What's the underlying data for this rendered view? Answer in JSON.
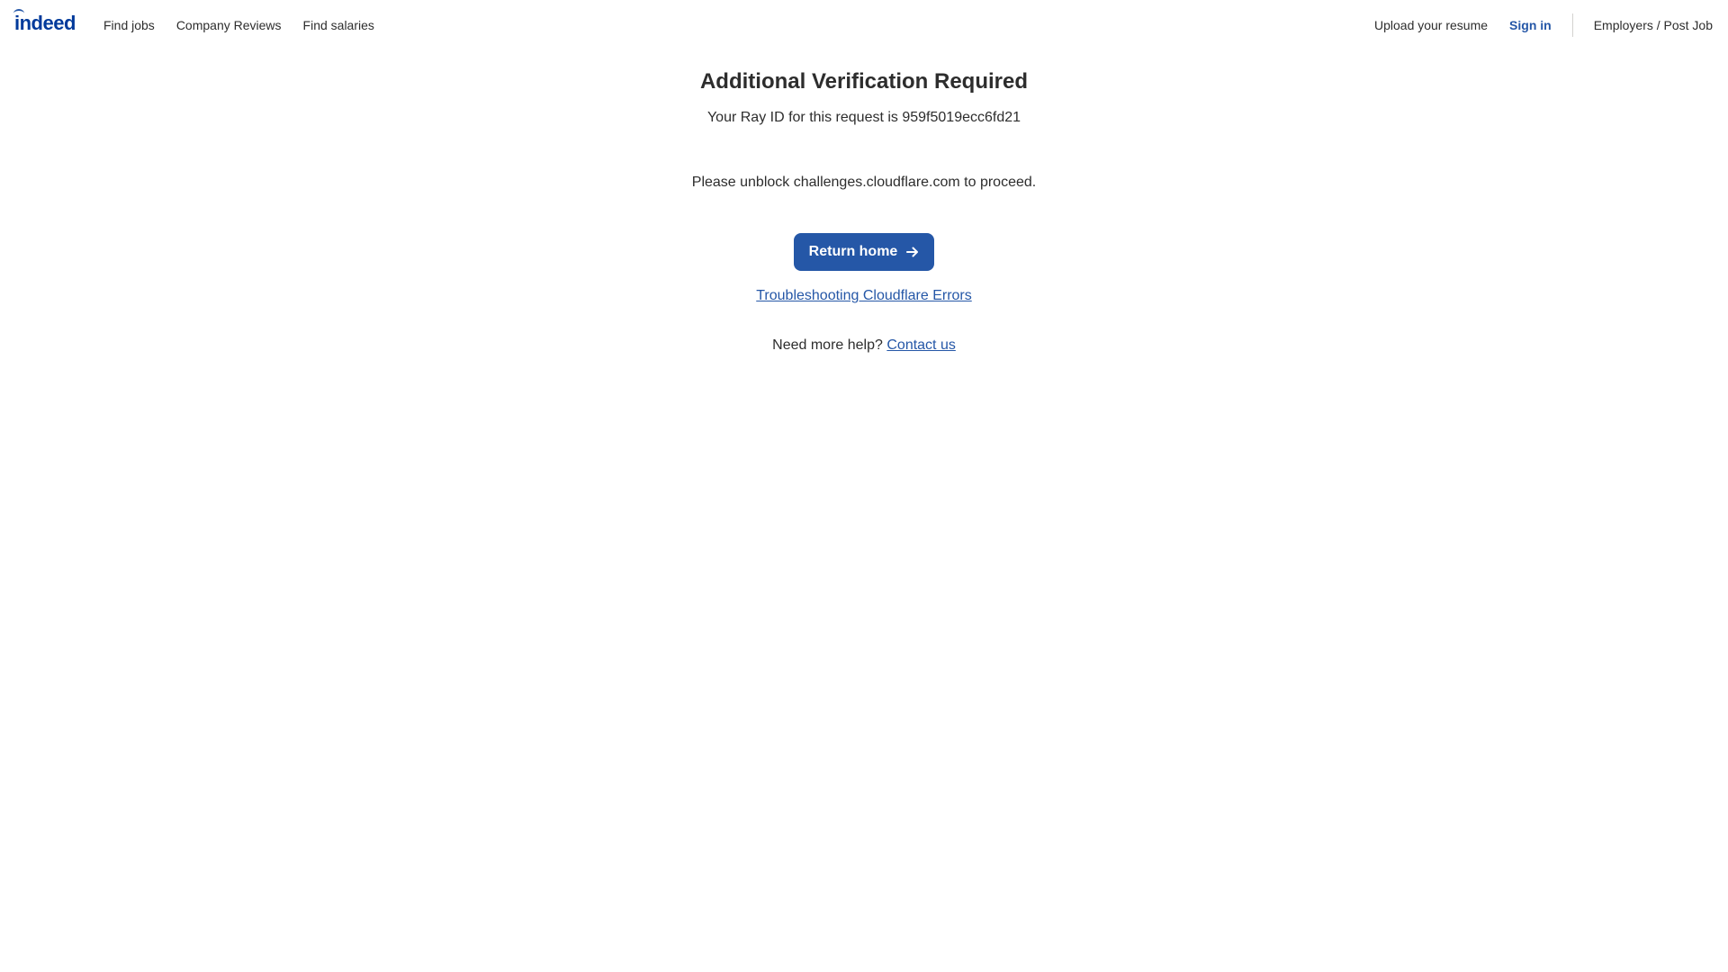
{
  "header": {
    "logo_text": "indeed",
    "nav_left": [
      {
        "label": "Find jobs"
      },
      {
        "label": "Company Reviews"
      },
      {
        "label": "Find salaries"
      }
    ],
    "upload_resume": "Upload your resume",
    "sign_in": "Sign in",
    "employers": "Employers / Post Job"
  },
  "main": {
    "title": "Additional Verification Required",
    "ray_id_text": "Your Ray ID for this request is 959f5019ecc6fd21",
    "unblock_text": "Please unblock challenges.cloudflare.com to proceed.",
    "return_home_label": "Return home",
    "troubleshooting_link": "Troubleshooting Cloudflare Errors",
    "help_prefix": "Need more help?",
    "contact_link": "Contact us"
  },
  "colors": {
    "brand_blue": "#2557a7",
    "logo_blue": "#003a9b",
    "text": "#2d2d2d"
  },
  "icons": {
    "return_arrow": "arrow-right-icon"
  }
}
